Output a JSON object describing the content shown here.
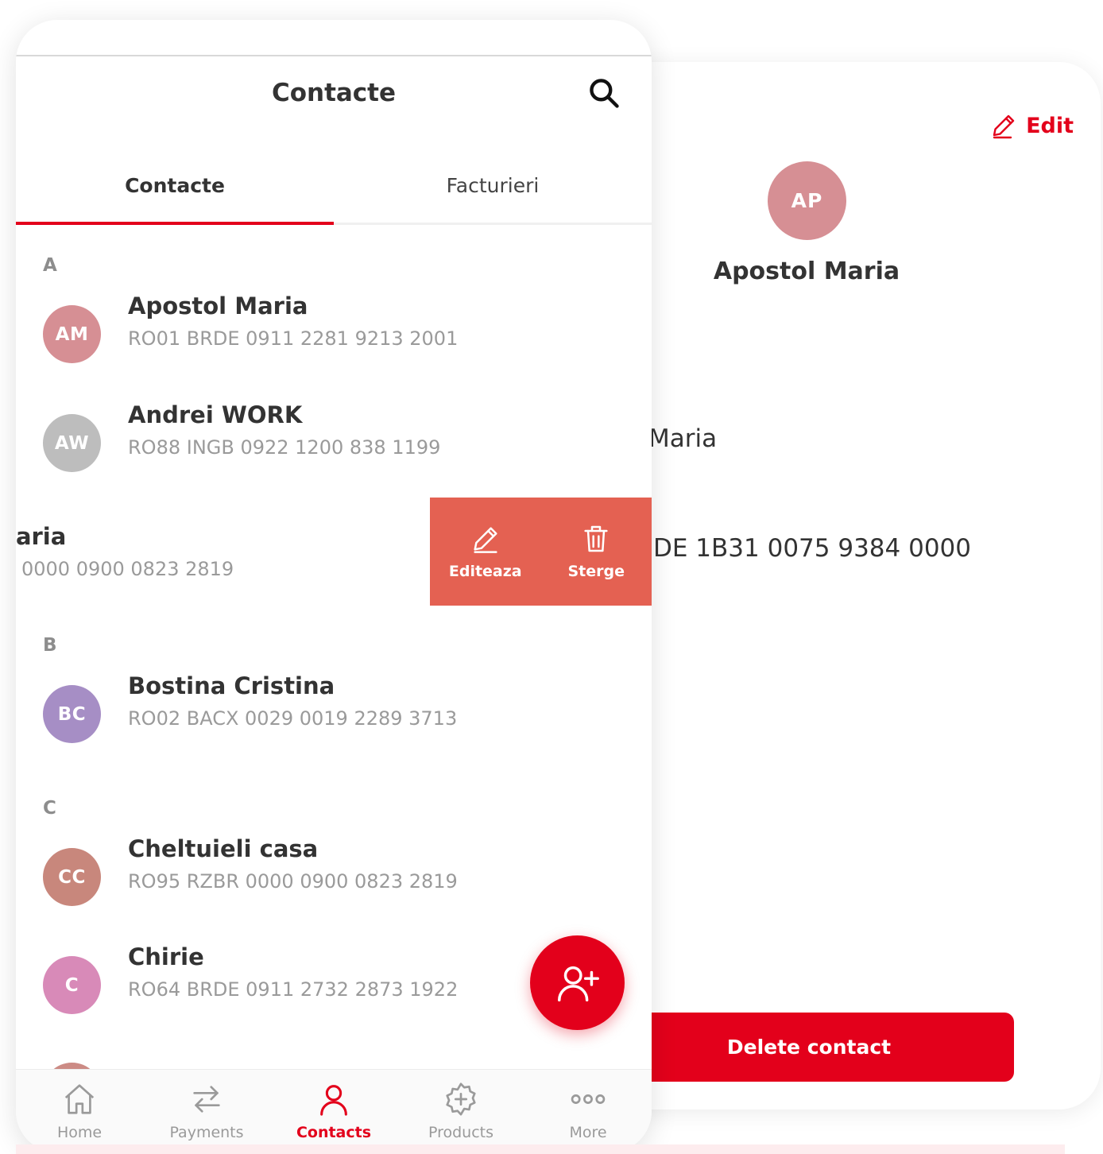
{
  "detail": {
    "edit_label": "Edit",
    "avatar_initials": "AP",
    "name": "Apostol Maria",
    "field_name_partial": "Maria",
    "field_iban_partial": "DE 1B31 0075 9384 0000",
    "delete_label": "Delete contact"
  },
  "header": {
    "title": "Contacte"
  },
  "tabs": [
    {
      "label": "Contacte",
      "active": true
    },
    {
      "label": "Facturieri",
      "active": false
    }
  ],
  "sections": [
    {
      "letter": "A"
    },
    {
      "letter": "B"
    },
    {
      "letter": "C"
    }
  ],
  "contacts": [
    {
      "initials": "AM",
      "name": "Apostol Maria",
      "iban": "RO01 BRDE 0911 2281 9213 2001",
      "color": "#d68f94"
    },
    {
      "initials": "AW",
      "name": "Andrei WORK",
      "iban": "RO88 INGB 0922 1200 838 1199",
      "color": "#bdbdbd"
    },
    {
      "initials": "BC",
      "name": "Bostina Cristina",
      "iban": "RO02 BACX 0029 0019 2289 3713",
      "color": "#a68ec5"
    },
    {
      "initials": "CC",
      "name": "Cheltuieli casa",
      "iban": "RO95 RZBR 0000 0900 0823 2819",
      "color": "#c8877c"
    },
    {
      "initials": "C",
      "name": "Chirie",
      "iban": "RO64 BRDE 0911 2732 2873 1922",
      "color": "#d88ab8"
    }
  ],
  "swiped": {
    "name_partial": "laria",
    "iban_partial": "0000 0900 0823 2819",
    "edit_label": "Editeaza",
    "delete_label": "Sterge"
  },
  "nav": [
    {
      "label": "Home",
      "icon": "home-icon"
    },
    {
      "label": "Payments",
      "icon": "transfer-arrows-icon"
    },
    {
      "label": "Contacts",
      "icon": "person-icon",
      "active": true
    },
    {
      "label": "Products",
      "icon": "gear-plus-icon"
    },
    {
      "label": "More",
      "icon": "dots-icon"
    }
  ],
  "colors": {
    "accent": "#e3001b",
    "swipe": "#e46152"
  }
}
